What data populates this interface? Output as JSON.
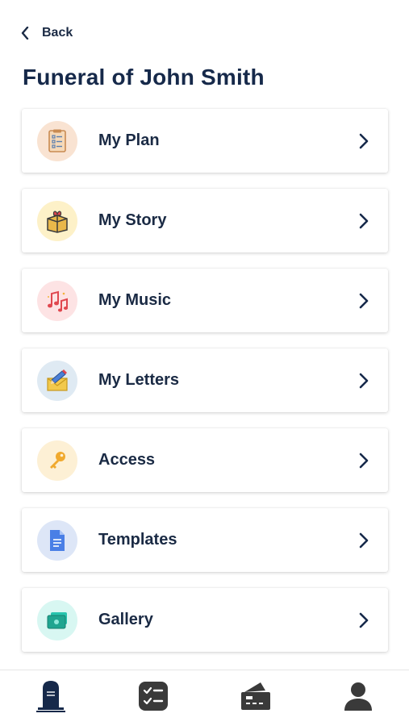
{
  "header": {
    "back_label": "Back",
    "title": "Funeral of John Smith"
  },
  "menu": [
    {
      "label": "My Plan",
      "icon": "checklist-clipboard-icon",
      "bg": "#f9e3d2"
    },
    {
      "label": "My Story",
      "icon": "gift-box-icon",
      "bg": "#fdf1c8"
    },
    {
      "label": "My Music",
      "icon": "music-notes-icon",
      "bg": "#fde3e4"
    },
    {
      "label": "My Letters",
      "icon": "envelope-pencil-icon",
      "bg": "#dfeaf3"
    },
    {
      "label": "Access",
      "icon": "key-icon",
      "bg": "#fdf0d5"
    },
    {
      "label": "Templates",
      "icon": "document-icon",
      "bg": "#dde6f7"
    },
    {
      "label": "Gallery",
      "icon": "photo-stack-icon",
      "bg": "#d8f7f2"
    }
  ],
  "tabbar": {
    "tabs": [
      {
        "icon": "tombstone-icon",
        "active": true
      },
      {
        "icon": "task-list-icon",
        "active": false
      },
      {
        "icon": "ticket-icon",
        "active": false
      },
      {
        "icon": "profile-icon",
        "active": false
      }
    ],
    "active_color": "#16294a",
    "inactive_color": "#3a3a3a"
  }
}
